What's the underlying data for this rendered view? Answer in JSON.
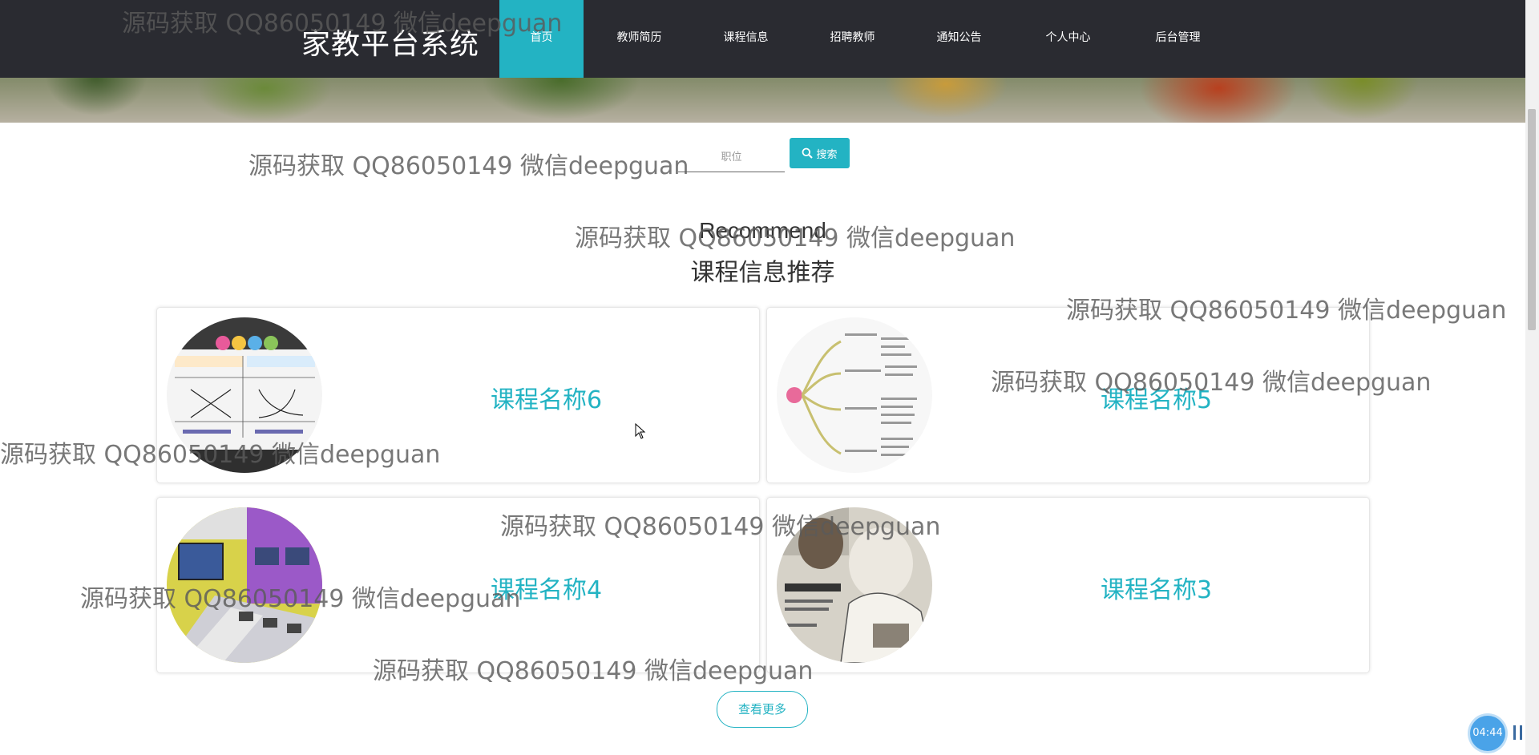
{
  "app": {
    "brand": "家教平台系统"
  },
  "nav": {
    "items": [
      {
        "label": "首页",
        "active": true
      },
      {
        "label": "教师简历",
        "active": false
      },
      {
        "label": "课程信息",
        "active": false
      },
      {
        "label": "招聘教师",
        "active": false
      },
      {
        "label": "通知公告",
        "active": false
      },
      {
        "label": "个人中心",
        "active": false
      },
      {
        "label": "后台管理",
        "active": false
      }
    ]
  },
  "search": {
    "placeholder": "职位",
    "value": "",
    "button_label": "搜索",
    "icon": "search-icon"
  },
  "section": {
    "title_en": "Recommend",
    "title_cn": "课程信息推荐"
  },
  "courses": [
    {
      "name": "课程名称6",
      "image": "function-graphs-review"
    },
    {
      "name": "课程名称5",
      "image": "mind-map"
    },
    {
      "name": "课程名称4",
      "image": "computer-classroom"
    },
    {
      "name": "课程名称3",
      "image": "textbook-illustration"
    }
  ],
  "more_label": "查看更多",
  "watermark_text": "源码获取 QQ86050149 微信deepguan",
  "timer": "04:44",
  "colors": {
    "accent": "#23b3c3",
    "navbar": "#2a2b31"
  }
}
